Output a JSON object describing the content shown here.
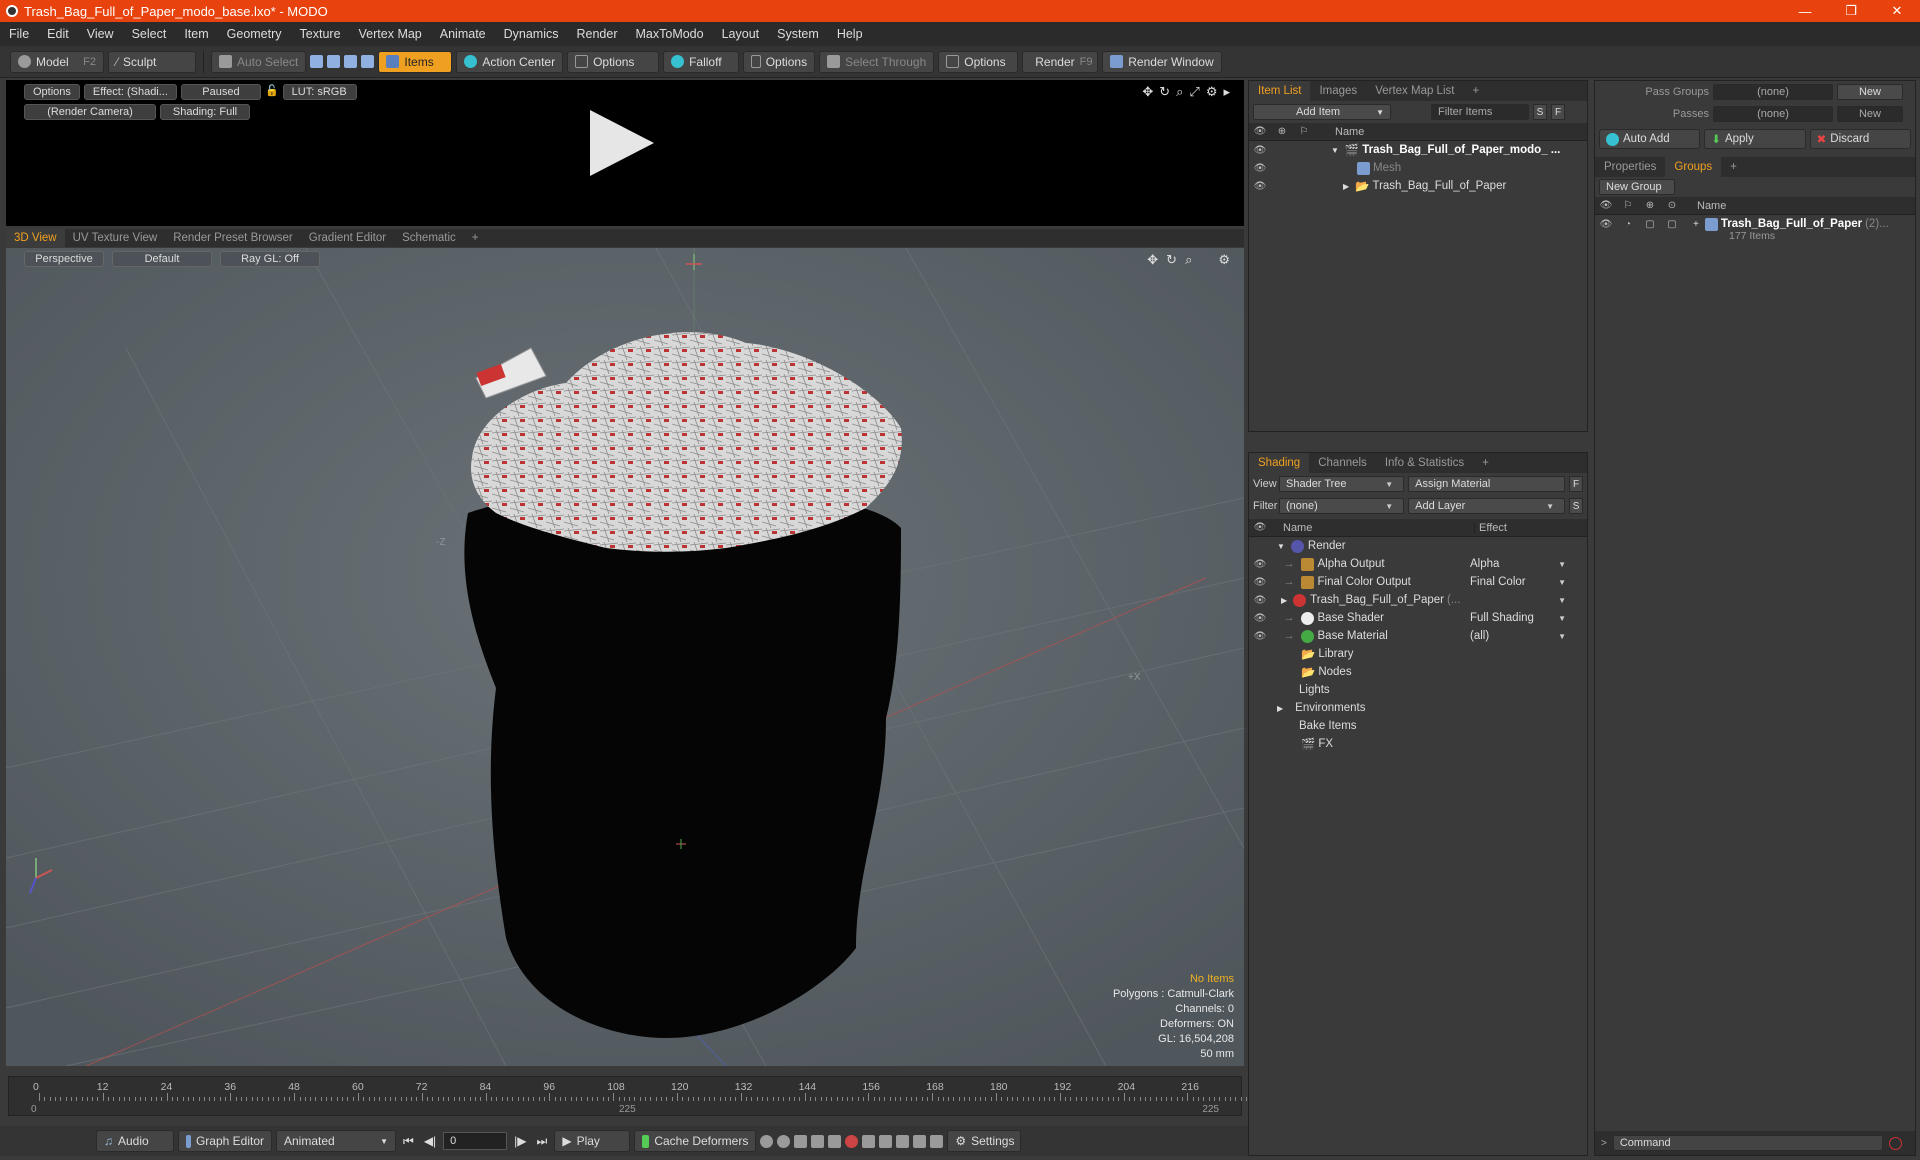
{
  "window": {
    "title": "Trash_Bag_Full_of_Paper_modo_base.lxo* - MODO",
    "controls": [
      "—",
      "❐",
      "✕"
    ]
  },
  "menu": [
    "File",
    "Edit",
    "View",
    "Select",
    "Item",
    "Geometry",
    "Texture",
    "Vertex Map",
    "Animate",
    "Dynamics",
    "Render",
    "MaxToModo",
    "Layout",
    "System",
    "Help"
  ],
  "toolbar": {
    "model": "Model",
    "model_key": "F2",
    "sculpt": "Sculpt",
    "auto_select": "Auto Select",
    "items": "Items",
    "action_center": "Action Center",
    "options1": "Options",
    "falloff": "Falloff",
    "options2": "Options",
    "select_through": "Select Through",
    "options3": "Options",
    "render": "Render",
    "render_key": "F9",
    "render_window": "Render Window"
  },
  "preview": {
    "options": "Options",
    "effect": "Effect: (Shadi...",
    "paused": "Paused",
    "lut": "LUT: sRGB",
    "camera": "(Render Camera)",
    "shading": "Shading: Full"
  },
  "viewport_tabs": [
    "3D View",
    "UV Texture View",
    "Render Preset Browser",
    "Gradient Editor",
    "Schematic",
    "+"
  ],
  "viewport": {
    "perspective": "Perspective",
    "default": "Default",
    "raygl": "Ray GL: Off",
    "info": {
      "no_items": "No Items",
      "polygons": "Polygons : Catmull-Clark",
      "channels": "Channels: 0",
      "deformers": "Deformers: ON",
      "gl": "GL: 16,504,208",
      "lens": "50 mm"
    },
    "axis_labels": [
      "-Z",
      "+X"
    ]
  },
  "timeline": {
    "ticks": [
      "0",
      "12",
      "24",
      "36",
      "48",
      "60",
      "72",
      "84",
      "96",
      "108",
      "120",
      "132",
      "144",
      "156",
      "168",
      "180",
      "192",
      "204",
      "216"
    ],
    "range_start": "0",
    "range_mid": "225",
    "range_end": "225"
  },
  "bottombar": {
    "audio": "Audio",
    "graph_editor": "Graph Editor",
    "animated": "Animated",
    "frame": "0",
    "play": "Play",
    "cache_deformers": "Cache Deformers",
    "settings": "Settings"
  },
  "item_list": {
    "tabs": [
      "Item List",
      "Images",
      "Vertex Map List",
      "+"
    ],
    "add_item": "Add Item",
    "filter_items": "Filter Items",
    "s_btn": "S",
    "f_btn": "F",
    "col_name": "Name",
    "rows": [
      {
        "label": "Trash_Bag_Full_of_Paper_modo_ ..."
      },
      {
        "label": "Mesh"
      },
      {
        "label": "Trash_Bag_Full_of_Paper"
      }
    ]
  },
  "shading": {
    "tabs": [
      "Shading",
      "Channels",
      "Info & Statistics",
      "+"
    ],
    "view_label": "View",
    "view_value": "Shader Tree",
    "assign_material": "Assign Material",
    "f_btn": "F",
    "filter_label": "Filter",
    "filter_value": "(none)",
    "add_layer": "Add Layer",
    "s_btn": "S",
    "col_name": "Name",
    "col_effect": "Effect",
    "rows": [
      {
        "label": "Render",
        "effect": ""
      },
      {
        "label": "Alpha Output",
        "effect": "Alpha"
      },
      {
        "label": "Final Color Output",
        "effect": "Final Color"
      },
      {
        "label": "Trash_Bag_Full_of_Paper",
        "suffix": "(...",
        "effect": ""
      },
      {
        "label": "Base Shader",
        "effect": "Full Shading"
      },
      {
        "label": "Base Material",
        "effect": "(all)"
      },
      {
        "label": "Library",
        "effect": ""
      },
      {
        "label": "Nodes",
        "effect": ""
      },
      {
        "label": "Lights",
        "effect": ""
      },
      {
        "label": "Environments",
        "effect": ""
      },
      {
        "label": "Bake Items",
        "effect": ""
      },
      {
        "label": "FX",
        "effect": ""
      }
    ]
  },
  "groups_panel": {
    "pass_groups_label": "Pass Groups",
    "pass_groups_value": "(none)",
    "passes_label": "Passes",
    "passes_value": "(none)",
    "new1": "New",
    "new2": "New",
    "auto_add": "Auto Add",
    "apply": "Apply",
    "discard": "Discard",
    "tabs": [
      "Properties",
      "Groups",
      "+"
    ],
    "new_group": "New Group",
    "col_name": "Name",
    "group_name": "Trash_Bag_Full_of_Paper",
    "group_count": "(2)...",
    "group_items": "177 Items",
    "command_placeholder": "Command"
  },
  "colors": {
    "titlebar": "#e8430e",
    "accent": "#f0a020",
    "viewport_bg": "#5d6469"
  }
}
